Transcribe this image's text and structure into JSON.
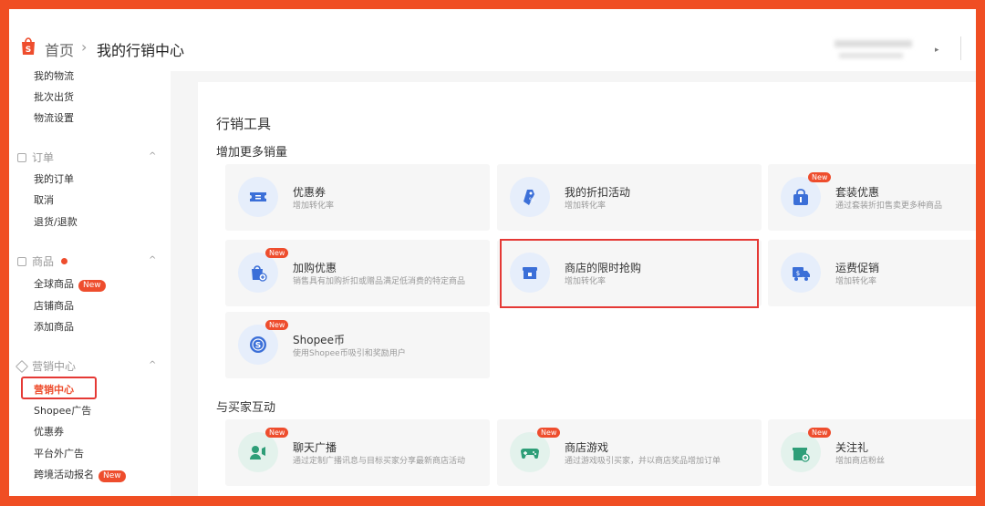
{
  "header": {
    "home": "首页",
    "separator": "›",
    "current": "我的行销中心",
    "user_arrow": "▸"
  },
  "sidebar": {
    "items_top": [
      "我的物流",
      "批次出货",
      "物流设置"
    ],
    "order": {
      "label": "订单",
      "items": [
        "我的订单",
        "取消",
        "退货/退款"
      ]
    },
    "product": {
      "label": "商品",
      "items": [
        "全球商品",
        "店铺商品",
        "添加商品"
      ],
      "new_badge": "New"
    },
    "marketing": {
      "label": "营销中心",
      "active": "营销中心",
      "items": [
        "Shopee广告",
        "优惠券",
        "平台外广告",
        "跨境活动报名"
      ],
      "new_badge": "New"
    },
    "chevron": "^"
  },
  "main": {
    "title": "行销工具",
    "section1": "增加更多销量",
    "section2": "与买家互动",
    "cards": [
      {
        "title": "优惠券",
        "desc": "增加转化率",
        "icon": "ticket-icon",
        "badge": ""
      },
      {
        "title": "我的折扣活动",
        "desc": "增加转化率",
        "icon": "tag-icon",
        "badge": ""
      },
      {
        "title": "套装优惠",
        "desc": "通过套装折扣售卖更多种商品",
        "icon": "bundle-icon",
        "badge": "New"
      },
      {
        "title": "加购优惠",
        "desc": "销售具有加购折扣或赠品满足低消费的特定商品",
        "icon": "addon-bag-icon",
        "badge": "New"
      },
      {
        "title": "商店的限时抢购",
        "desc": "增加转化率",
        "icon": "store-flash-icon",
        "badge": ""
      },
      {
        "title": "运费促销",
        "desc": "增加转化率",
        "icon": "truck-icon",
        "badge": ""
      },
      {
        "title": "Shopee币",
        "desc": "使用Shopee币吸引和奖励用户",
        "icon": "coin-icon",
        "badge": "New"
      },
      {
        "title": "聊天广播",
        "desc": "通过定制广播讯息与目标买家分享最新商店活动",
        "icon": "chat-broadcast-icon",
        "badge": "New"
      },
      {
        "title": "商店游戏",
        "desc": "通过游戏吸引买家，并以商店奖品增加订单",
        "icon": "gamepad-icon",
        "badge": "New"
      },
      {
        "title": "关注礼",
        "desc": "增加商店粉丝",
        "icon": "follow-gift-icon",
        "badge": "New"
      }
    ]
  },
  "colors": {
    "accent": "#ee4d2d",
    "highlight": "#e53935",
    "icon_blue": "#3b6fd8",
    "icon_green": "#2e9e78"
  }
}
